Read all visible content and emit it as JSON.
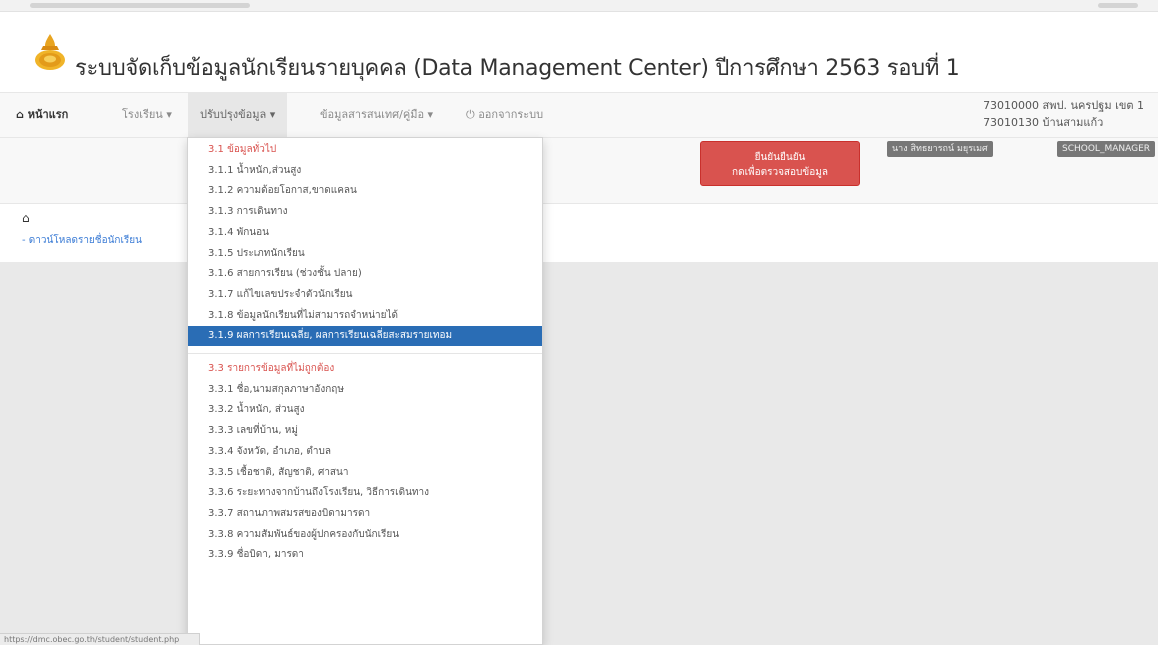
{
  "app": {
    "title": "ระบบจัดเก็บข้อมูลนักเรียนรายบุคคล (Data Management Center) ปีการศึกษา 2563 รอบที่ 1"
  },
  "navbar": {
    "home": "หน้าแรก",
    "school": "โรงเรียน ▾",
    "update": "ปรับปรุงข้อมูล ▾",
    "info": "ข้อมูลสารสนเทศ/คู่มือ ▾",
    "logout": "ออกจากระบบ",
    "area_code": "73010000 สพป. นครปฐม เขต 1",
    "school_code": "73010130 บ้านสามแก้ว"
  },
  "toolbar": {
    "confirm_line1": "ยืนยันยืนยัน",
    "confirm_line2": "กดเพื่อตรวจสอบข้อมูล",
    "user_name": "นาง สิทธยารถน์ มยุรเมศ",
    "user_role": "SCHOOL_MANAGER"
  },
  "breadcrumb": {
    "home_icon": "home-icon",
    "link": "ดาวน์โหลดรายชื่อนักเรียน"
  },
  "dropdown": {
    "group1_header": "3.1 ข้อมูลทั่วไป",
    "group1_items": [
      "3.1.1 น้ำหนัก,ส่วนสูง",
      "3.1.2 ความด้อยโอกาส,ขาดแคลน",
      "3.1.3 การเดินทาง",
      "3.1.4 พักนอน",
      "3.1.5 ประเภทนักเรียน",
      "3.1.6 สายการเรียน (ช่วงชั้น ปลาย)",
      "3.1.7 แก้ไขเลขประจำตัวนักเรียน",
      "3.1.8 ข้อมูลนักเรียนที่ไม่สามารถจำหน่ายได้",
      "3.1.9 ผลการเรียนเฉลี่ย, ผลการเรียนเฉลี่ยสะสมรายเทอม"
    ],
    "selected_index": 8,
    "group2_header": "3.3 รายการข้อมูลที่ไม่ถูกต้อง",
    "group2_items": [
      "3.3.1 ชื่อ,นามสกุลภาษาอังกฤษ",
      "3.3.2 น้ำหนัก, ส่วนสูง",
      "3.3.3 เลขที่บ้าน, หมู่",
      "3.3.4 จังหวัด, อำเภอ, ตำบล",
      "3.3.5 เชื้อชาติ, สัญชาติ, ศาสนา",
      "3.3.6 ระยะทางจากบ้านถึงโรงเรียน, วิธีการเดินทาง",
      "3.3.7 สถานภาพสมรสของบิดามารดา",
      "3.3.8 ความสัมพันธ์ของผู้ปกครองกับนักเรียน",
      "3.3.9 ชื่อบิดา, มารดา"
    ]
  },
  "statusbar": {
    "url": "https://dmc.obec.go.th/student/student.php"
  },
  "colors": {
    "accent_red": "#d9534f",
    "selected_blue": "#2a6db5",
    "navbar_bg": "#f8f8f8",
    "content_bg": "#e9e9e9"
  }
}
